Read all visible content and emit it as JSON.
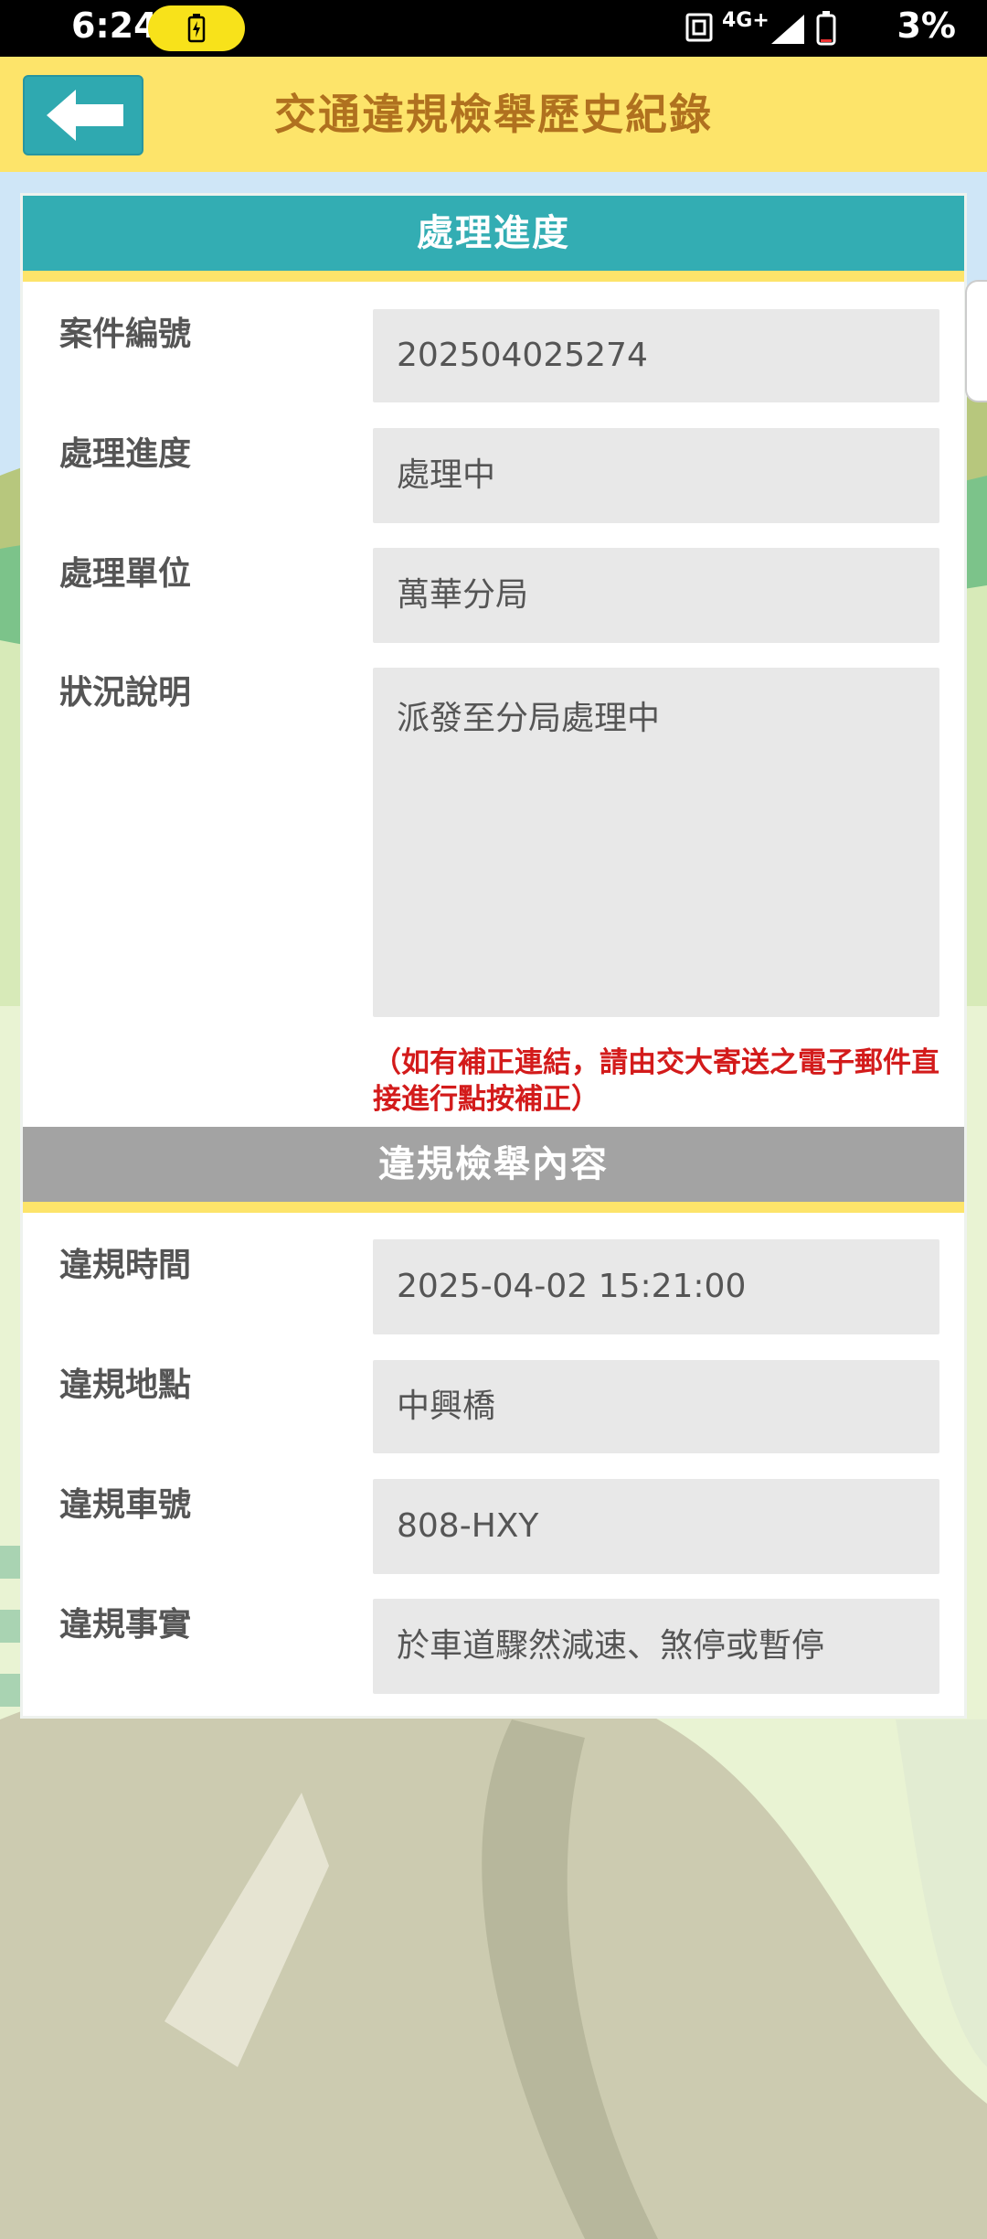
{
  "status_bar": {
    "time": "6:24",
    "network": "4G+",
    "battery": "3%"
  },
  "header": {
    "back_icon": "arrow-left-icon",
    "title": "交通違規檢舉歷史紀錄"
  },
  "progress_section": {
    "title": "處理進度",
    "fields": [
      {
        "label": "案件編號",
        "value": "202504025274"
      },
      {
        "label": "處理進度",
        "value": "處理中"
      },
      {
        "label": "處理單位",
        "value": "萬華分局"
      },
      {
        "label": "狀況說明",
        "value": "派發至分局處理中"
      }
    ],
    "notice": "（如有補正連結，請由交大寄送之電子郵件直接進行點按補正）"
  },
  "report_section": {
    "title": "違規檢舉內容",
    "fields": [
      {
        "label": "違規時間",
        "value": "2025-04-02 15:21:00"
      },
      {
        "label": "違規地點",
        "value": "中興橋"
      },
      {
        "label": "違規車號",
        "value": "808-HXY"
      },
      {
        "label": "違規事實",
        "value": "於車道驟然減速、煞停或暫停"
      }
    ]
  },
  "colors": {
    "header_bg": "#fde46a",
    "title_color": "#b0711f",
    "teal": "#33adb3",
    "notice_red": "#d31b1b"
  }
}
